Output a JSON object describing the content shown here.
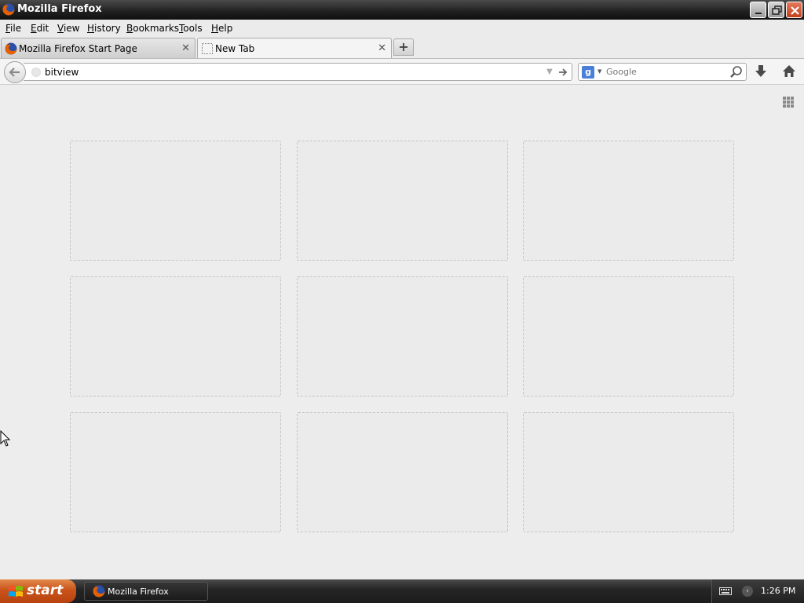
{
  "window": {
    "title": "Mozilla Firefox",
    "accent_color": "#c1401a"
  },
  "menu": {
    "items": [
      {
        "label": "File",
        "underline": "F"
      },
      {
        "label": "Edit",
        "underline": "E"
      },
      {
        "label": "View",
        "underline": "V"
      },
      {
        "label": "History",
        "underline": "H"
      },
      {
        "label": "Bookmarks",
        "underline": "B"
      },
      {
        "label": "Tools",
        "underline": "T"
      },
      {
        "label": "Help",
        "underline": "H"
      }
    ]
  },
  "tabs": [
    {
      "title": "Mozilla Firefox Start Page",
      "icon": "firefox-icon",
      "active": false
    },
    {
      "title": "New Tab",
      "icon": "blank-page-icon",
      "active": true
    }
  ],
  "tab_controls": {
    "close_glyph": "✕",
    "new_tab_glyph": "+"
  },
  "navbar": {
    "url_value": "bitview",
    "search_engine": "Google",
    "search_placeholder": "Google",
    "engine_letter": "g"
  },
  "newtab_page": {
    "tile_count": 9,
    "tiles_empty": true
  },
  "taskbar": {
    "start_label": "start",
    "task_label": "Mozilla Firefox",
    "clock": "1:26 PM"
  }
}
